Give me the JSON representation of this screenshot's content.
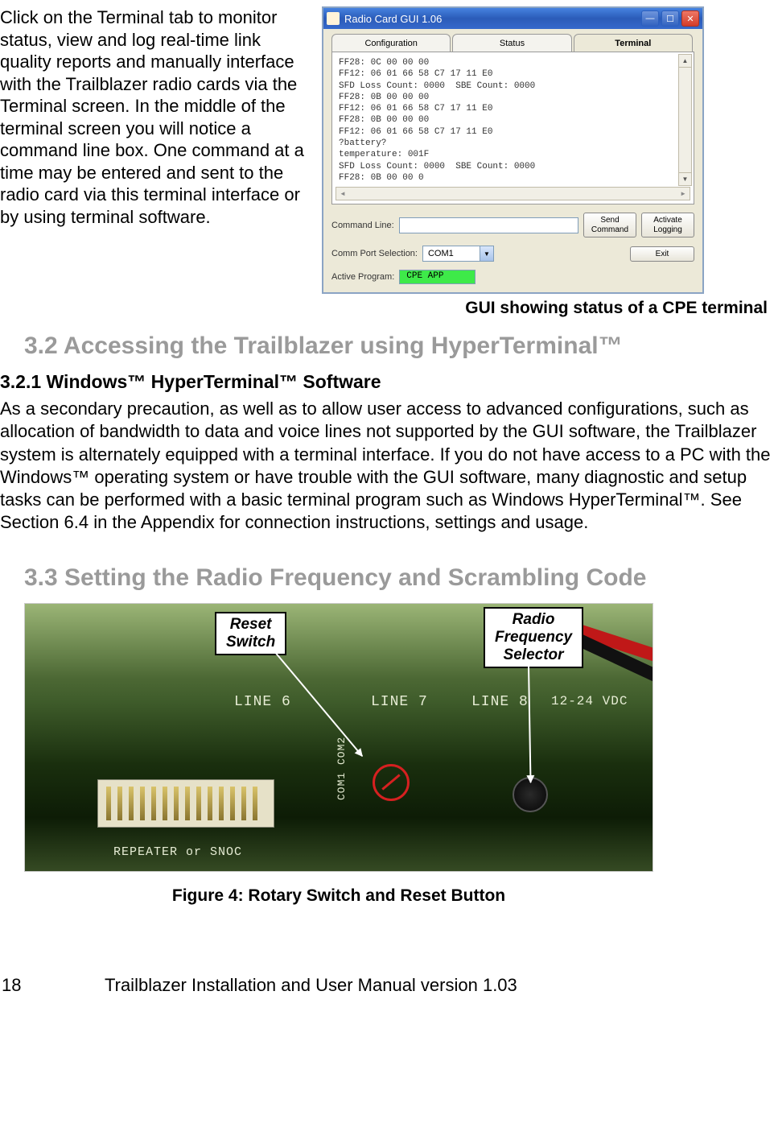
{
  "intro_paragraph": "Click on the Terminal tab to monitor status, view and log real-time link quality reports and manually interface with the Trailblazer radio cards via the Terminal screen. In the middle of the terminal screen you will notice a command line box. One command at a time may be entered and sent to the radio card via this terminal interface or by using terminal software.",
  "gui_window": {
    "title": "Radio Card GUI 1.06",
    "tabs": [
      "Configuration",
      "Status",
      "Terminal"
    ],
    "active_tab_index": 2,
    "terminal_lines": "FF28: 0C 00 00 00\nFF12: 06 01 66 58 C7 17 11 E0\nSFD Loss Count: 0000  SBE Count: 0000\nFF28: 0B 00 00 00\nFF12: 06 01 66 58 C7 17 11 E0\nFF28: 0B 00 00 00\nFF12: 06 01 66 58 C7 17 11 E0\n?battery?\ntemperature: 001F\nSFD Loss Count: 0000  SBE Count: 0000\nFF28: 0B 00 00 0",
    "command_line_label": "Command Line:",
    "command_line_value": "",
    "send_button": "Send\nCommand",
    "activate_button": "Activate\nLogging",
    "comm_port_label": "Comm Port Selection:",
    "comm_port_value": "COM1",
    "active_program_label": "Active Program:",
    "active_program_value": "CPE APP",
    "exit_button": "Exit"
  },
  "gui_caption": "GUI showing status of a CPE terminal",
  "section_3_2": "3.2 Accessing the Trailblazer using HyperTerminal™",
  "subsection_3_2_1": "3.2.1  Windows™ HyperTerminal™ Software",
  "paragraph_3_2_1": "As a secondary precaution, as well as to allow user access to advanced configurations, such as allocation of bandwidth to data and voice lines not supported by the GUI software, the Trailblazer system is alternately equipped with a terminal interface. If you do not have access to a PC with the Windows™ operating system or have trouble with the GUI software, many diagnostic and setup tasks can be performed with a basic terminal program such as Windows HyperTerminal™. See Section 6.4 in the Appendix for connection instructions, settings and usage.",
  "section_3_3": "3.3 Setting the Radio Frequency and Scrambling Code",
  "figure4": {
    "callout_reset": "Reset\nSwitch",
    "callout_freq": "Radio\nFrequency\nSelector",
    "silk_line6": "LINE 6",
    "silk_line7": "LINE 7",
    "silk_line8": "LINE 8",
    "silk_vdc": "12-24 VDC",
    "silk_repeater": "REPEATER or SNOC",
    "silk_com": "COM1 COM2",
    "caption": "Figure 4: Rotary Switch and Reset Button"
  },
  "footer": {
    "page_number": "18",
    "doc_title": "Trailblazer Installation and User Manual version 1.03"
  }
}
